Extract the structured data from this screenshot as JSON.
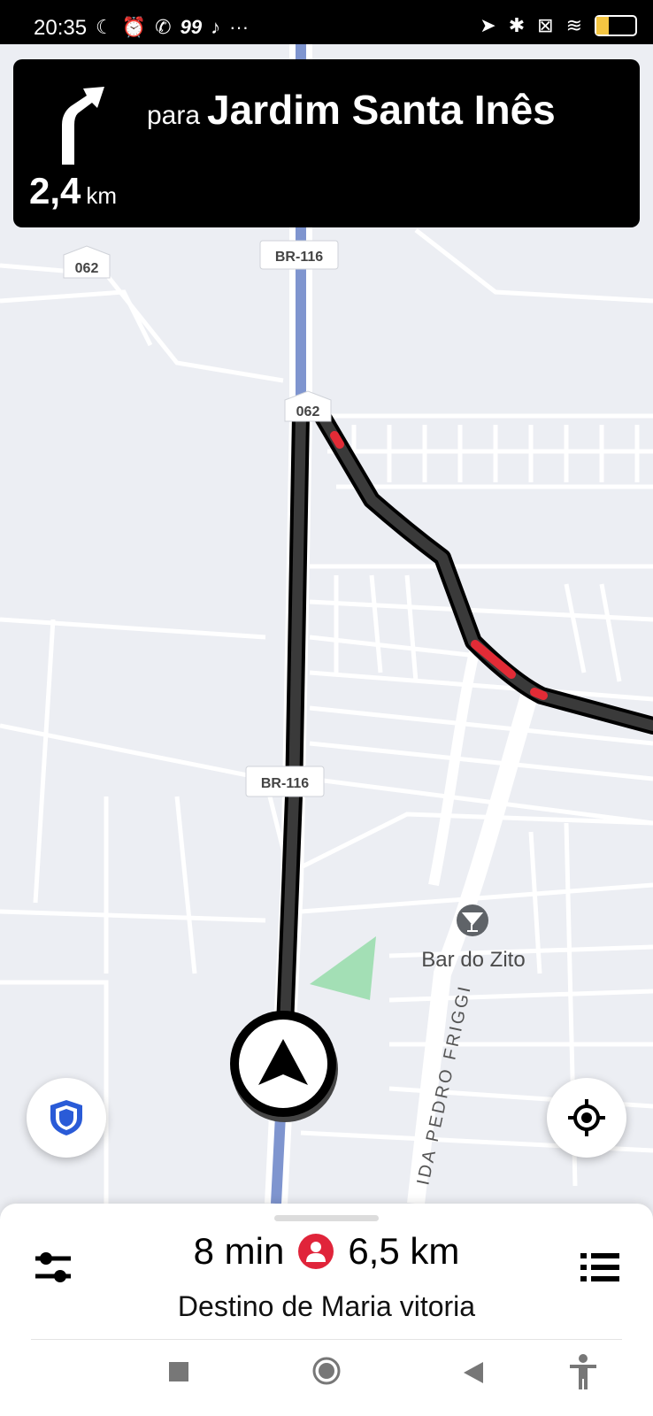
{
  "status_bar": {
    "time": "20:35",
    "notification_icons": [
      "moon-icon",
      "alarm-icon",
      "whatsapp-icon",
      "99-app-icon",
      "tiktok-icon",
      "more-icon"
    ],
    "app_99_label": "99",
    "more_label": "···",
    "system_icons": [
      "location-arrow-icon",
      "bluetooth-icon",
      "no-sim-icon",
      "wifi-icon",
      "battery-icon"
    ],
    "battery_level": 31,
    "battery_label": "31"
  },
  "navigation": {
    "maneuver_icon": "turn-slight-left-icon",
    "distance_value": "2,4",
    "distance_unit": "km",
    "preposition": "para",
    "destination_street": "Jardim Santa Inês"
  },
  "map": {
    "road_shields": [
      "062",
      "BR-116",
      "062",
      "BR-116"
    ],
    "poi": {
      "name": "Bar do Zito",
      "icon": "cocktail-icon"
    },
    "street_label": "IDA PEDRO FRIGGI",
    "colors": {
      "route": "#3a3a3a",
      "traffic": "#e22b36",
      "highway": "#7f95cf",
      "park": "#a3dfb5",
      "background": "#eceef3"
    }
  },
  "buttons": {
    "safety_icon": "shield-icon",
    "recenter_icon": "crosshair-icon"
  },
  "trip_summary": {
    "eta": "8 min",
    "rider_icon": "person-icon",
    "distance": "6,5 km",
    "destination": "Destino de Maria vitoria",
    "settings_icon": "sliders-icon",
    "list_icon": "list-icon"
  },
  "system_nav": {
    "icons": [
      "square-recents-icon",
      "circle-home-icon",
      "triangle-back-icon",
      "accessibility-icon"
    ]
  }
}
